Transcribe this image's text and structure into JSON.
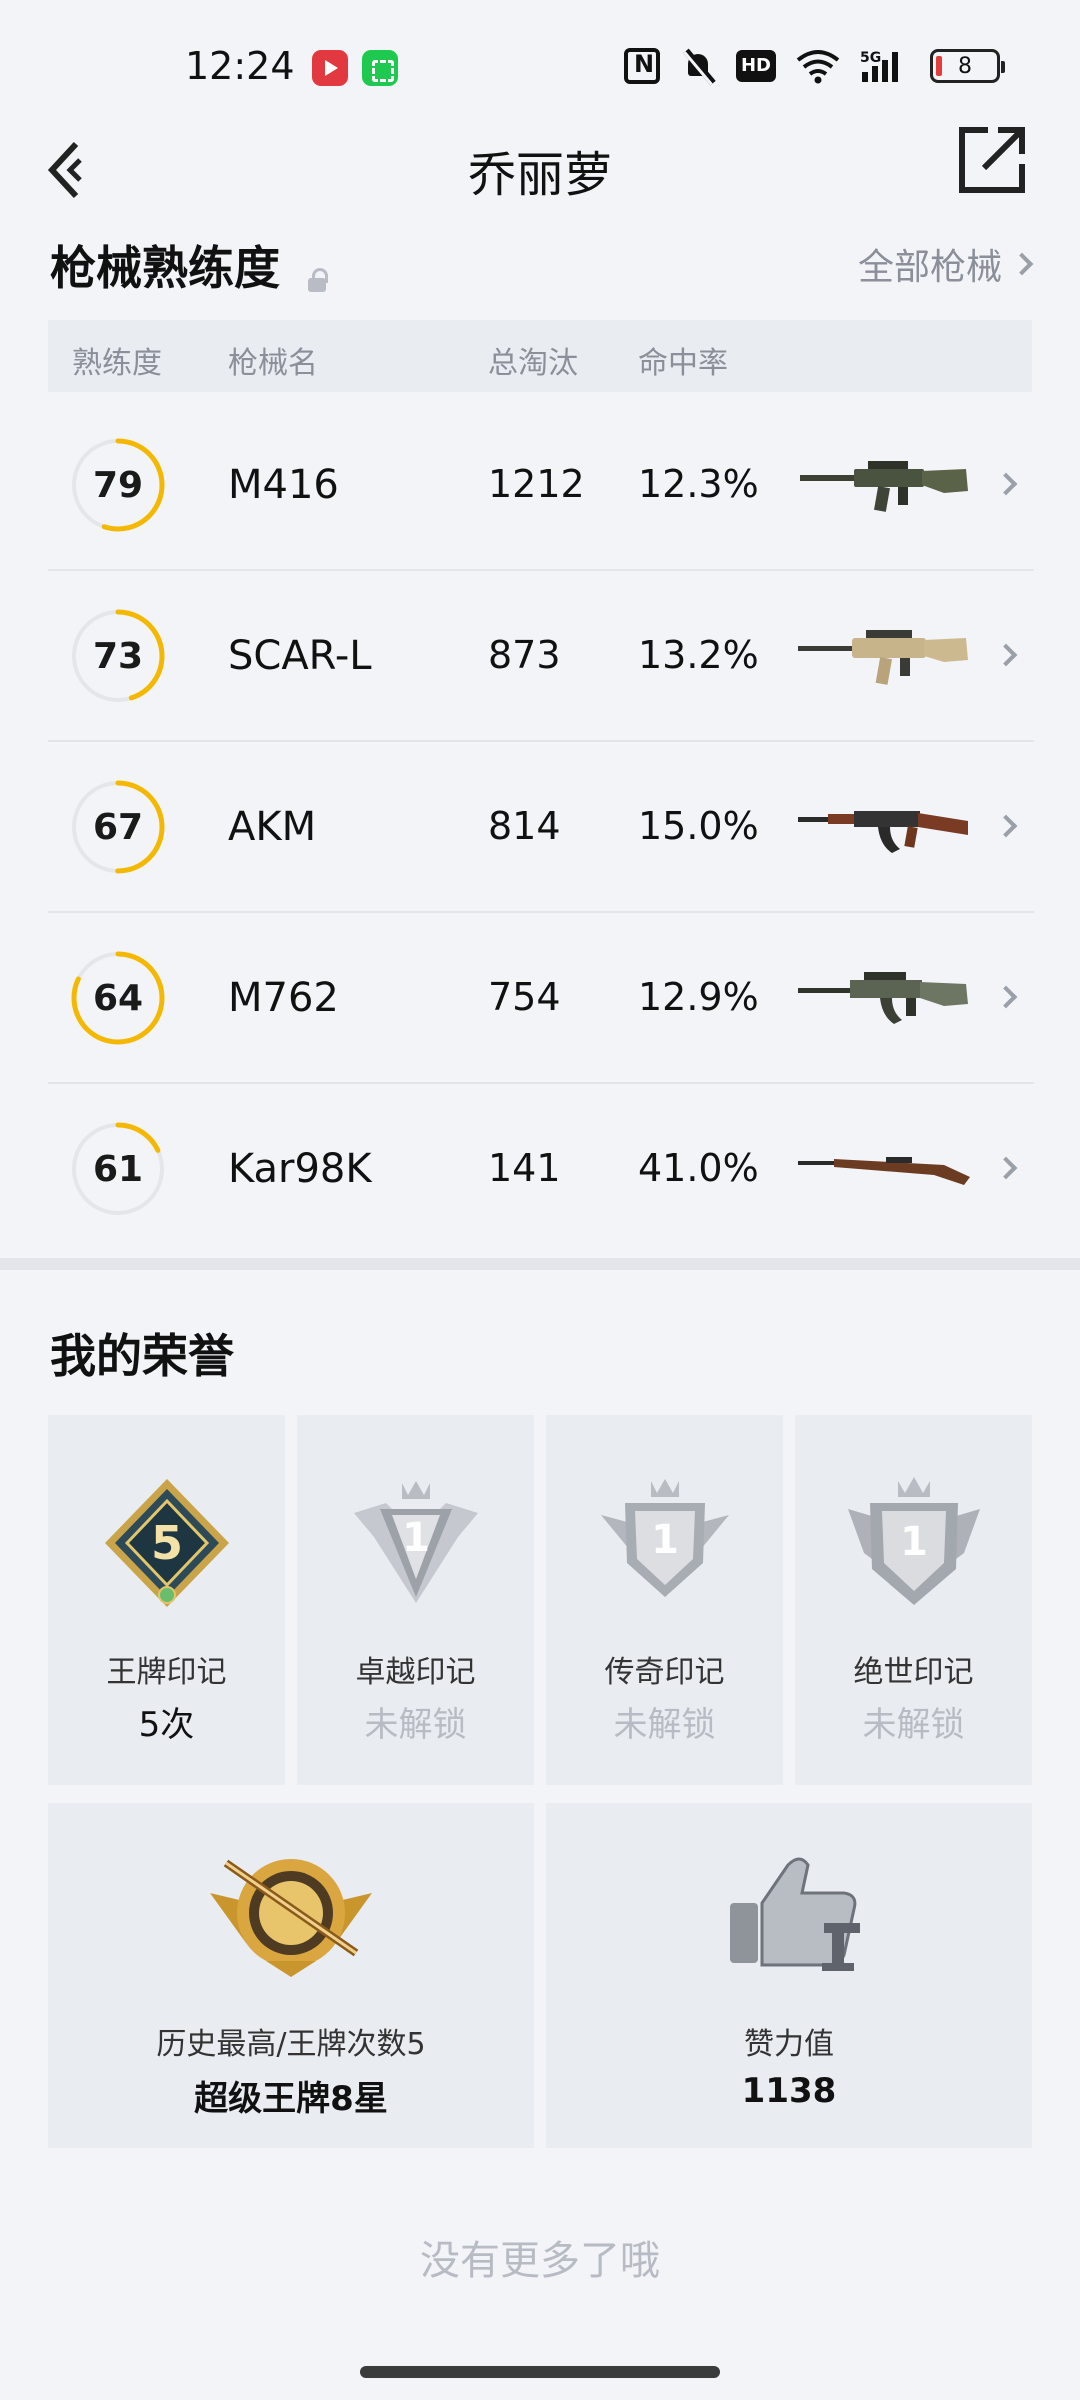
{
  "status_bar": {
    "time": "12:24",
    "battery": "8",
    "icons": [
      "video-app-icon",
      "green-app-icon",
      "nfc-icon",
      "mute-icon",
      "hd-icon",
      "wifi-icon",
      "signal-5g-icon",
      "battery-icon"
    ]
  },
  "nav": {
    "title": "乔丽萝",
    "back_icon": "back-arrow-icon",
    "share_icon": "share-external-icon"
  },
  "weapons_section": {
    "title": "枪械熟练度",
    "all_link": "全部枪械",
    "headers": [
      "熟练度",
      "枪械名",
      "总淘汰",
      "命中率"
    ],
    "rows": [
      {
        "level": "79",
        "name": "M416",
        "kills": "1212",
        "rate": "12.3%",
        "progress": 0.55,
        "gun": "m416"
      },
      {
        "level": "73",
        "name": "SCAR-L",
        "kills": "873",
        "rate": "13.2%",
        "progress": 0.45,
        "gun": "scar"
      },
      {
        "level": "67",
        "name": "AKM",
        "kills": "814",
        "rate": "15.0%",
        "progress": 0.5,
        "gun": "akm"
      },
      {
        "level": "64",
        "name": "M762",
        "kills": "754",
        "rate": "12.9%",
        "progress": 0.82,
        "gun": "m762"
      },
      {
        "level": "61",
        "name": "Kar98K",
        "kills": "141",
        "rate": "41.0%",
        "progress": 0.18,
        "gun": "kar98k"
      }
    ]
  },
  "honors_section": {
    "title": "我的荣誉",
    "marks": [
      {
        "name": "王牌印记",
        "value": "5次",
        "locked": false,
        "badge": "5"
      },
      {
        "name": "卓越印记",
        "value": "未解锁",
        "locked": true,
        "badge": "1"
      },
      {
        "name": "传奇印记",
        "value": "未解锁",
        "locked": true,
        "badge": "1"
      },
      {
        "name": "绝世印记",
        "value": "未解锁",
        "locked": true,
        "badge": "1"
      }
    ],
    "highest": {
      "name": "历史最高/王牌次数5",
      "value": "超级王牌8星"
    },
    "likes": {
      "name": "赞力值",
      "value": "1138"
    }
  },
  "footer": {
    "no_more": "没有更多了哦"
  },
  "colors": {
    "accent_ring": "#f5b800",
    "ring_track": "#e3e6eb",
    "background": "#f2f4f8"
  }
}
